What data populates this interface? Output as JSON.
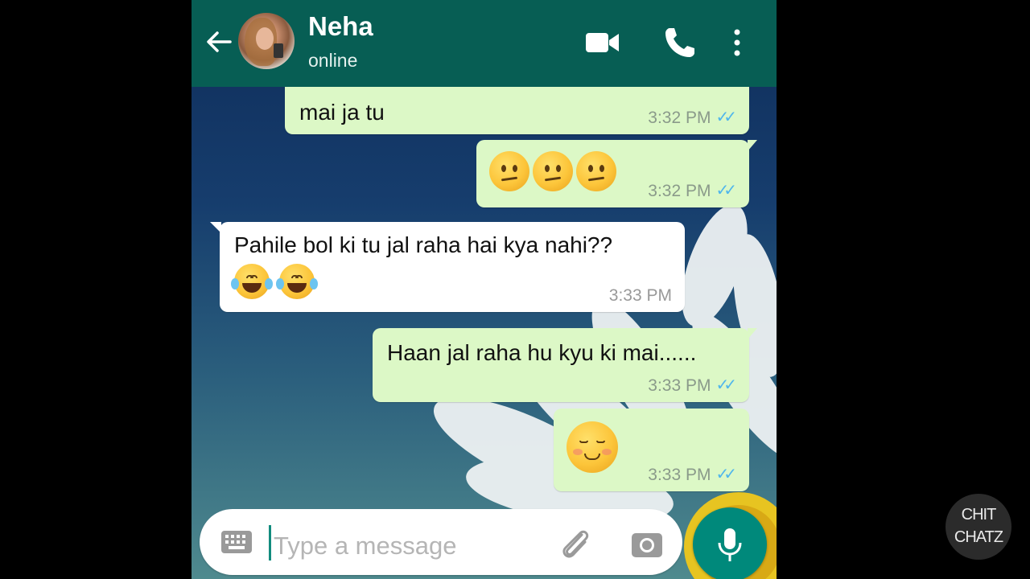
{
  "header": {
    "contact_name": "Neha",
    "contact_status": "online",
    "icons": [
      "back-arrow-icon",
      "video-call-icon",
      "phone-call-icon",
      "more-vert-icon"
    ],
    "color": "#075e54"
  },
  "messages": [
    {
      "direction": "out",
      "text": "mai ja tu",
      "time": "3:32 PM",
      "status": "read"
    },
    {
      "direction": "out",
      "emoji": [
        "confused-face",
        "confused-face",
        "confused-face"
      ],
      "time": "3:32 PM",
      "status": "read"
    },
    {
      "direction": "in",
      "text": "Pahile bol ki tu jal raha hai kya nahi??",
      "emoji": [
        "face-with-tears-of-joy",
        "face-with-tears-of-joy"
      ],
      "time": "3:33 PM"
    },
    {
      "direction": "out",
      "text": "Haan jal raha hu kyu ki mai......",
      "time": "3:33 PM",
      "status": "read"
    },
    {
      "direction": "out",
      "emoji": [
        "smiling-face"
      ],
      "time": "3:33 PM",
      "status": "read"
    }
  ],
  "composer": {
    "placeholder": "Type a message",
    "icons": [
      "keyboard-icon",
      "attach-icon",
      "camera-icon",
      "mic-icon"
    ]
  },
  "colors": {
    "outgoing_bubble": "#dcf8c6",
    "incoming_bubble": "#ffffff",
    "read_tick": "#4fb6ec",
    "mic_button": "#00897b"
  },
  "watermark": {
    "line1": "CHIT",
    "line2": "CHATZ"
  }
}
